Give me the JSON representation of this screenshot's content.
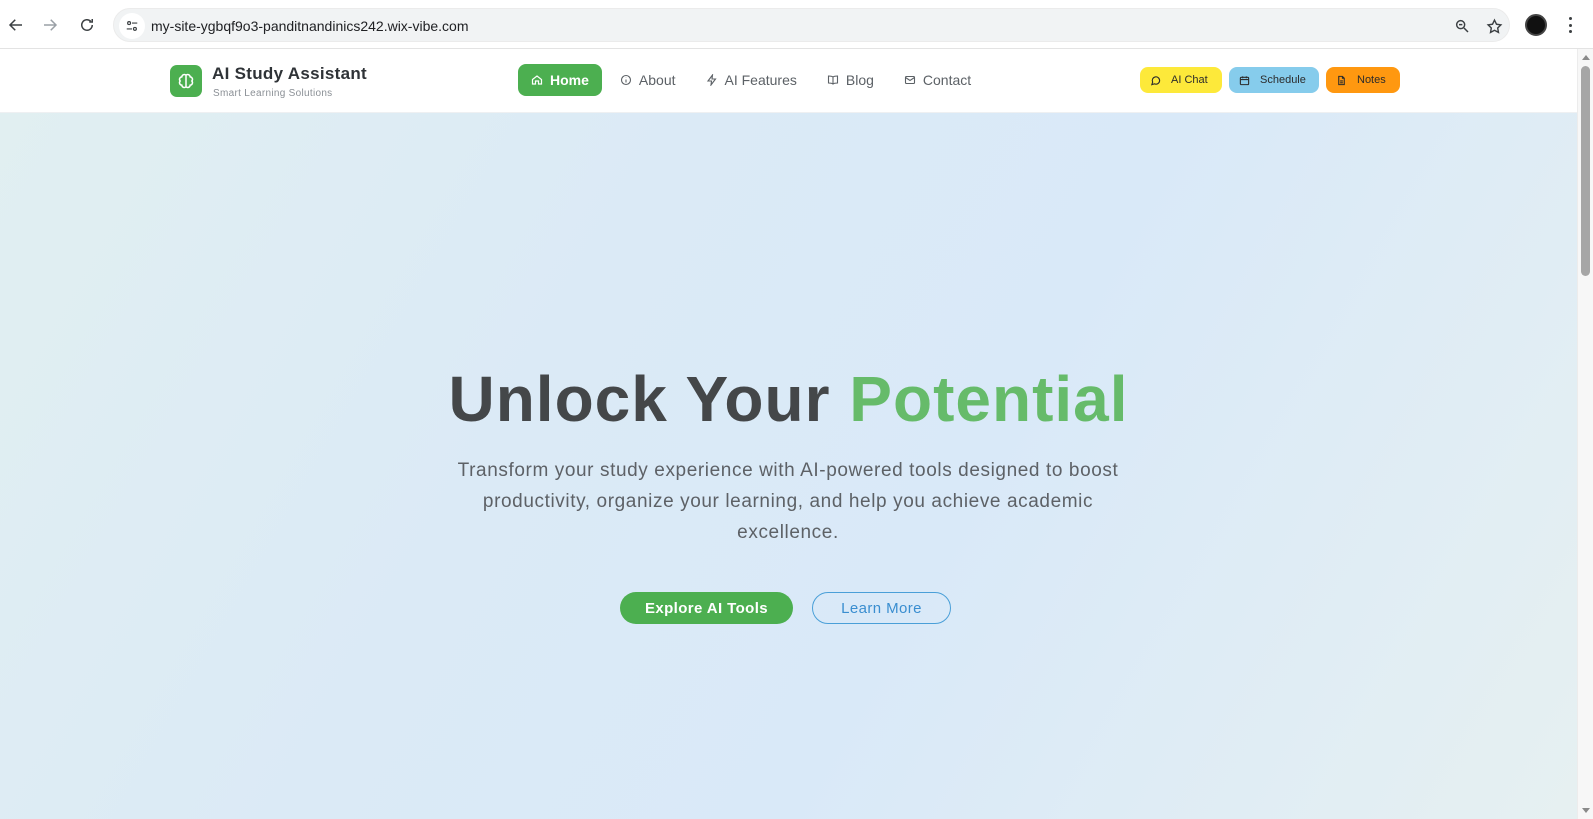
{
  "browser": {
    "url": "my-site-ygbqf9o3-panditnandinics242.wix-vibe.com",
    "icons": [
      "back-icon",
      "forward-icon",
      "reload-icon",
      "site-info-icon",
      "zoom-icon",
      "star-icon",
      "profile-avatar",
      "menu-icon"
    ]
  },
  "header": {
    "brand_title": "AI Study Assistant",
    "brand_subtitle": "Smart Learning Solutions",
    "nav": [
      {
        "label": "Home",
        "icon": "home-icon",
        "active": true
      },
      {
        "label": "About",
        "icon": "info-icon",
        "active": false
      },
      {
        "label": "AI Features",
        "icon": "lightning-icon",
        "active": false
      },
      {
        "label": "Blog",
        "icon": "book-icon",
        "active": false
      },
      {
        "label": "Contact",
        "icon": "mail-icon",
        "active": false
      }
    ],
    "quick_actions": [
      {
        "label": "AI Chat",
        "icon": "chat-icon",
        "color": "#fde93a"
      },
      {
        "label": "Schedule",
        "icon": "calendar-icon",
        "color": "#86ccec"
      },
      {
        "label": "Notes",
        "icon": "document-icon",
        "color": "#ff9810"
      }
    ]
  },
  "hero": {
    "title_part1": "Unlock Your ",
    "title_accent": "Potential",
    "description": "Transform your study experience with AI-powered tools designed to boost productivity, organize your learning, and help you achieve academic excellence.",
    "primary_cta": "Explore AI Tools",
    "secondary_cta": "Learn More"
  },
  "colors": {
    "brand_green": "#4caf50",
    "accent_green": "#66bb6a",
    "link_blue": "#3a8ed0"
  }
}
